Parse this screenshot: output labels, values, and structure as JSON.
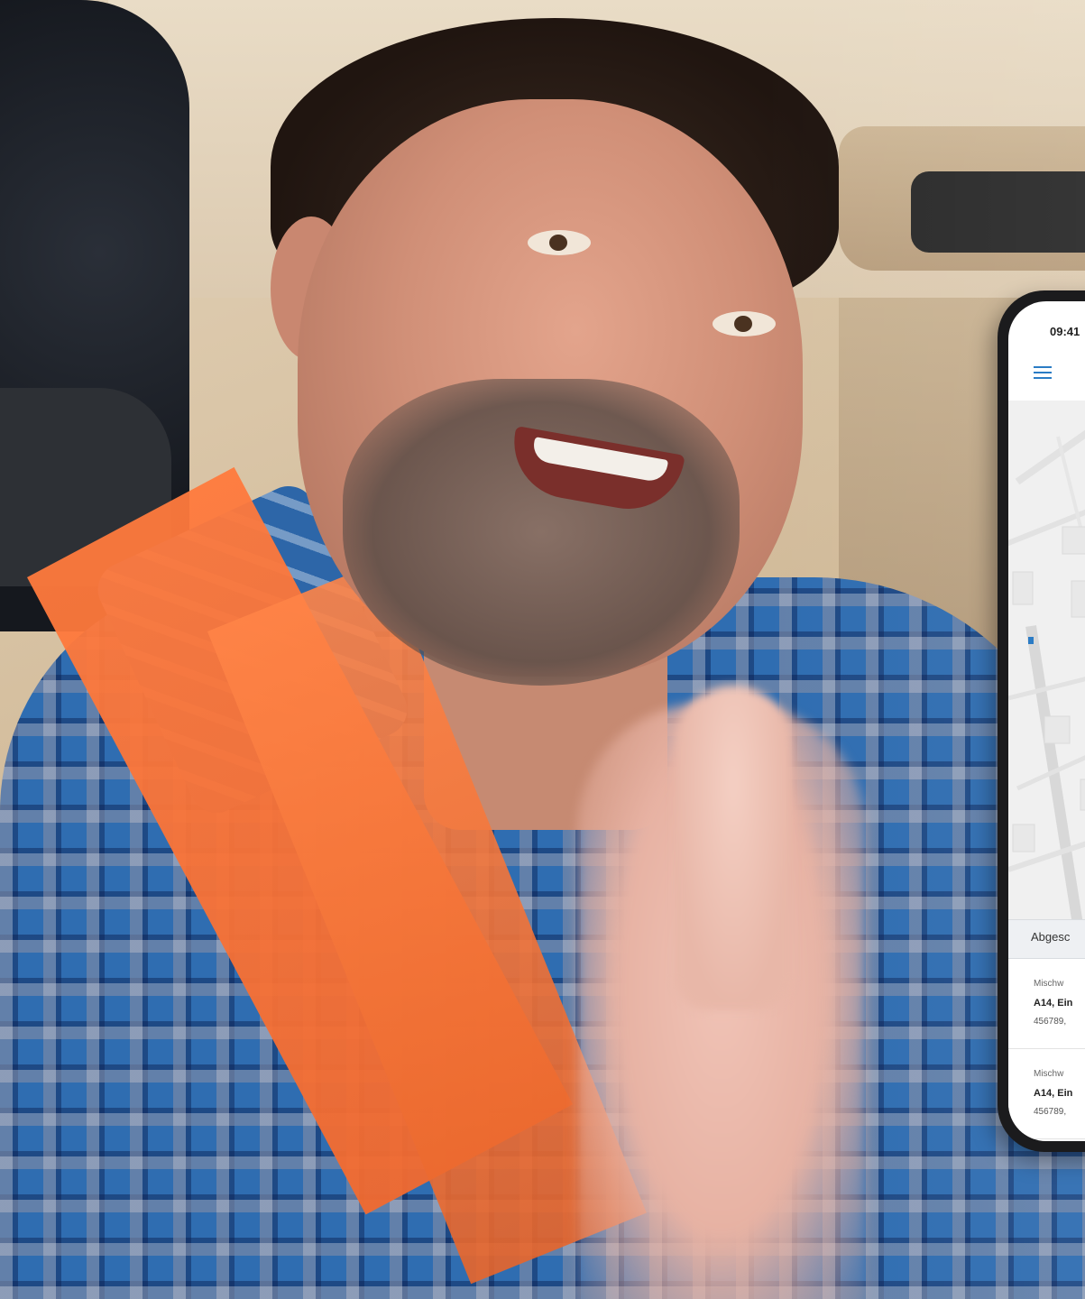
{
  "phone": {
    "status_time": "09:41",
    "menu_icon": "hamburger-menu-icon",
    "accent_color": "#2b7cc5",
    "section_title": "Abgesc",
    "cards": [
      {
        "type": "Mischw",
        "title": "A14, Ein",
        "subtitle": "456789,"
      },
      {
        "type": "Mischw",
        "title": "A14, Ein",
        "subtitle": "456789,"
      }
    ]
  }
}
